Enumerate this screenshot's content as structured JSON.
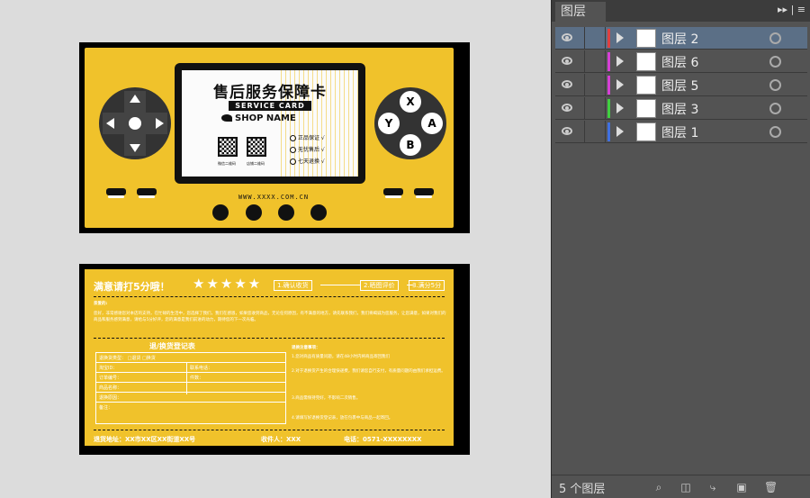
{
  "front": {
    "title": "售后服务保障卡",
    "service_card": "SERVICE CARD",
    "shop_name": "SHOP NAME",
    "qr1_label": "微信二维码",
    "qr2_label": "店铺二维码",
    "guarantees": [
      "正品保证 √",
      "无忧售后 √",
      "七天退换 √"
    ],
    "url": "WWW.XXXX.COM.CN",
    "buttons": {
      "x": "X",
      "y": "Y",
      "a": "A",
      "b": "B"
    }
  },
  "back": {
    "heading": "满意请打5分哦！",
    "stars": "★★★★★",
    "steps": [
      "1.确认收货",
      "2.晒图评价",
      "3.满分5分"
    ],
    "intro_label": "亲爱的:",
    "intro_text": "您好，非常感谢您对本店的支持，在忙碌的生活中，您选择了我们，我们在感恩，如果您收到商品，无论任何原因，有不满意的地方，请先联系我们，我们将竭诚为您服务，让您满意，如果对我们的商品和服务感到满意，请给与5分好评，您的满意是我们前进的动力，期待您的下一次光临。",
    "form_title": "退/换货登记表",
    "form_rows": [
      "退换货类型：",
      "淘宝ID：",
      "订单编号：",
      "商品名称：",
      "退换原因：",
      "备注："
    ],
    "form_right": [
      "联系电话：",
      "件数："
    ],
    "form_options": [
      "退货",
      "换货"
    ],
    "notes_title": "退换注意事项：",
    "notes": [
      "1.您对商品有质量问题，请在48小时内将商品寄回我们",
      "2.对于退换货产生的合理快递费，我们请您自行支付，有质量问题的由我们承担运费。",
      "3.商品需保持完好，不影响二次销售。",
      "4.请填写好退换货登记表，放在包裹中与商品一起寄回。"
    ],
    "footer_address": "退货地址：XX市XX区XX街道XX号",
    "footer_receiver": "收件人：XXX",
    "footer_phone": "电话：0571-XXXXXXXX"
  },
  "panel": {
    "tab": "图层",
    "menu": "▸▸ | ≡",
    "layers": [
      {
        "name": "图层 2",
        "color": "#e04040",
        "selected": true
      },
      {
        "name": "图层 6",
        "color": "#d640d6",
        "selected": false
      },
      {
        "name": "图层 5",
        "color": "#d640d6",
        "selected": false
      },
      {
        "name": "图层 3",
        "color": "#40d040",
        "selected": false
      },
      {
        "name": "图层 1",
        "color": "#4070e0",
        "selected": false
      }
    ],
    "count": "5 个图层"
  }
}
